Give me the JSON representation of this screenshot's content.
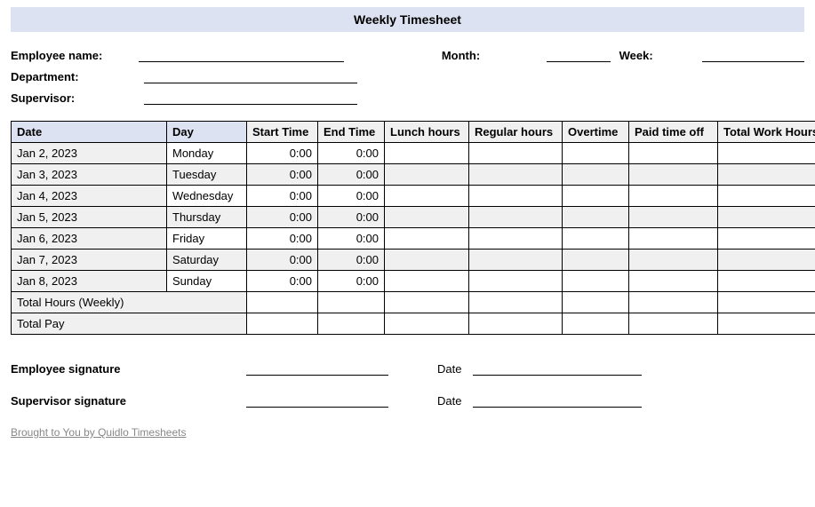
{
  "title": "Weekly Timesheet",
  "fields": {
    "employee_name": "Employee name:",
    "department": "Department:",
    "supervisor": "Supervisor:",
    "month": "Month:",
    "week": "Week:"
  },
  "columns": {
    "date": "Date",
    "day": "Day",
    "start": "Start Time",
    "end": "End Time",
    "lunch": "Lunch hours",
    "regular": "Regular hours",
    "overtime": "Overtime",
    "pto": "Paid time off",
    "total": "Total Work Hours"
  },
  "rows": [
    {
      "date": "Jan 2, 2023",
      "day": "Monday",
      "start": "0:00",
      "end": "0:00"
    },
    {
      "date": "Jan 3, 2023",
      "day": "Tuesday",
      "start": "0:00",
      "end": "0:00"
    },
    {
      "date": "Jan 4, 2023",
      "day": "Wednesday",
      "start": "0:00",
      "end": "0:00"
    },
    {
      "date": "Jan 5, 2023",
      "day": "Thursday",
      "start": "0:00",
      "end": "0:00"
    },
    {
      "date": "Jan 6, 2023",
      "day": "Friday",
      "start": "0:00",
      "end": "0:00"
    },
    {
      "date": "Jan 7, 2023",
      "day": "Saturday",
      "start": "0:00",
      "end": "0:00"
    },
    {
      "date": "Jan 8, 2023",
      "day": "Sunday",
      "start": "0:00",
      "end": "0:00"
    }
  ],
  "summary_rows": {
    "total_hours": "Total Hours (Weekly)",
    "total_pay": "Total Pay"
  },
  "signatures": {
    "employee": "Employee signature",
    "supervisor": "Supervisor signature",
    "date": "Date"
  },
  "footer": "Brought to You by Quidlo Timesheets"
}
